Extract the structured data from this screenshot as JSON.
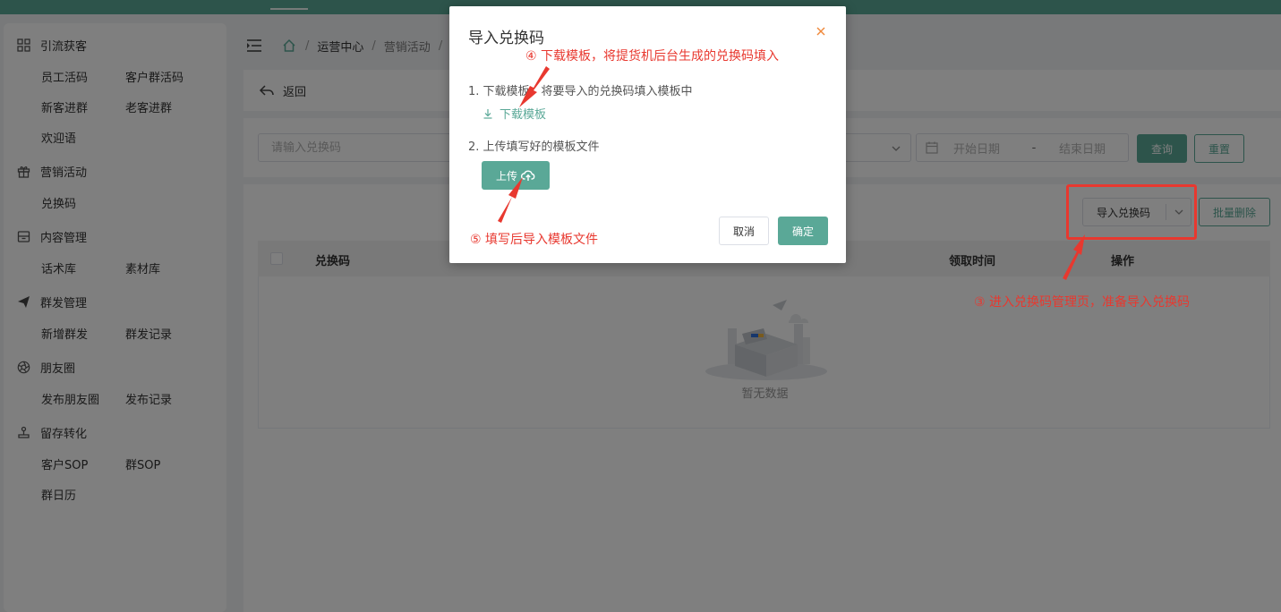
{
  "sidebar": {
    "groups": [
      {
        "label": "引流获客",
        "icon": "grid-icon",
        "items": [
          "员工活码",
          "客户群活码",
          "新客进群",
          "老客进群",
          "欢迎语"
        ]
      },
      {
        "label": "营销活动",
        "icon": "gift-icon",
        "items": [
          "兑换码"
        ]
      },
      {
        "label": "内容管理",
        "icon": "archive-icon",
        "items": [
          "话术库",
          "素材库"
        ]
      },
      {
        "label": "群发管理",
        "icon": "send-icon",
        "items": [
          "新增群发",
          "群发记录"
        ]
      },
      {
        "label": "朋友圈",
        "icon": "aperture-icon",
        "items": [
          "发布朋友圈",
          "发布记录"
        ]
      },
      {
        "label": "留存转化",
        "icon": "joystick-icon",
        "items": [
          "客户SOP",
          "群SOP",
          "群日历"
        ]
      }
    ]
  },
  "breadcrumb": {
    "items": [
      "运营中心",
      "营销活动"
    ]
  },
  "back": {
    "label": "返回"
  },
  "filters": {
    "code_placeholder": "请输入兑换码",
    "date_start_placeholder": "开始日期",
    "date_sep": "-",
    "date_end_placeholder": "结束日期",
    "query_label": "查询",
    "reset_label": "重置"
  },
  "toolbar": {
    "import_label": "导入兑换码",
    "bulk_delete_label": "批量删除"
  },
  "table": {
    "columns": [
      "兑换码",
      "领取时间",
      "操作"
    ],
    "empty_text": "暂无数据"
  },
  "modal": {
    "title": "导入兑换码",
    "step1_text": "1. 下载模板，将要导入的兑换码填入模板中",
    "download_label": "下载模板",
    "step2_text": "2. 上传填写好的模板文件",
    "upload_label": "上传",
    "cancel_label": "取消",
    "confirm_label": "确定"
  },
  "annotations": {
    "step4": "④ 下载模板，将提货机后台生成的兑换码填入",
    "step5": "⑤ 填写后导入模板文件",
    "step3": "③ 进入兑换码管理页，准备导入兑换码"
  },
  "colors": {
    "brand": "#5aa897",
    "annotation": "#e8382f",
    "close_icon": "#f0883a"
  }
}
